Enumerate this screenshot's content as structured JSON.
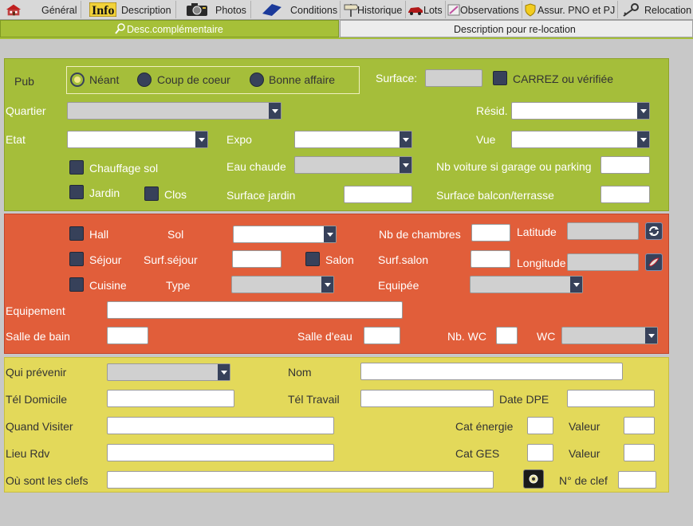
{
  "tabs": [
    {
      "label": "Général",
      "icon": "house-icon"
    },
    {
      "label": "Description",
      "icon": "info-icon"
    },
    {
      "label": "Photos",
      "icon": "camera-icon"
    },
    {
      "label": "Conditions",
      "icon": "book-icon"
    },
    {
      "label": "Historique",
      "icon": "signpost-icon"
    },
    {
      "label": "Lots",
      "icon": "car-icon"
    },
    {
      "label": "Observations",
      "icon": "note-icon"
    },
    {
      "label": "Assur. PNO et PJ",
      "icon": "shield-icon"
    },
    {
      "label": "Relocation",
      "icon": "keys-icon"
    }
  ],
  "subtabs": {
    "left": "Desc.complémentaire",
    "right": "Description pour re-location"
  },
  "colors": {
    "green": "#a5be3a",
    "orange": "#e15e3a",
    "yellow": "#e3d95a",
    "control_dark": "#37415a"
  },
  "green": {
    "pub_label": "Pub",
    "pub_options": [
      "Néant",
      "Coup de coeur",
      "Bonne affaire"
    ],
    "pub_selected": "Néant",
    "surface_label": "Surface:",
    "surface_value": "",
    "carrez_label": "CARREZ ou vérifiée",
    "quartier_label": "Quartier",
    "resid_label": "Résid.",
    "etat_label": "Etat",
    "expo_label": "Expo",
    "vue_label": "Vue",
    "chauffage_label": "Chauffage sol",
    "eau_chaude_label": "Eau chaude",
    "nb_voiture_label": "Nb voiture si garage ou parking",
    "jardin_label": "Jardin",
    "clos_label": "Clos",
    "surface_jardin_label": "Surface jardin",
    "surface_balcon_label": "Surface balcon/terrasse"
  },
  "orange": {
    "hall_label": "Hall",
    "sol_label": "Sol",
    "nb_chambres_label": "Nb de chambres",
    "latitude_label": "Latitude",
    "sejour_label": "Séjour",
    "surf_sejour_label": "Surf.séjour",
    "salon_label": "Salon",
    "surf_salon_label": "Surf.salon",
    "longitude_label": "Longitude",
    "cuisine_label": "Cuisine",
    "type_label": "Type",
    "equipee_label": "Equipée",
    "equipement_label": "Equipement",
    "salle_bain_label": "Salle de bain",
    "salle_eau_label": "Salle d'eau",
    "nb_wc_label": "Nb. WC",
    "wc_label": "WC"
  },
  "yellow": {
    "qui_prevenir_label": "Qui prévenir",
    "nom_label": "Nom",
    "tel_domicile_label": "Tél Domicile",
    "tel_travail_label": "Tél Travail",
    "date_dpe_label": "Date DPE",
    "quand_visiter_label": "Quand Visiter",
    "cat_energie_label": "Cat énergie",
    "valeur1_label": "Valeur",
    "lieu_rdv_label": "Lieu Rdv",
    "cat_ges_label": "Cat GES",
    "valeur2_label": "Valeur",
    "ou_clefs_label": "Où sont les clefs",
    "no_clef_label": "N° de clef"
  }
}
